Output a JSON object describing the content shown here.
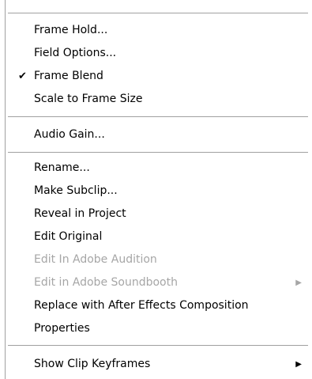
{
  "menu": {
    "items": [
      {
        "label": "Frame Hold...",
        "enabled": true,
        "checked": false
      },
      {
        "label": "Field Options...",
        "enabled": true,
        "checked": false
      },
      {
        "label": "Frame Blend",
        "enabled": true,
        "checked": true,
        "check_glyph": "✔"
      },
      {
        "label": "Scale to Frame Size",
        "enabled": true,
        "checked": false
      },
      {
        "label": "Audio Gain...",
        "enabled": true,
        "checked": false
      },
      {
        "label": "Rename...",
        "enabled": true,
        "checked": false
      },
      {
        "label": "Make Subclip...",
        "enabled": true,
        "checked": false
      },
      {
        "label": "Reveal in Project",
        "enabled": true,
        "checked": false
      },
      {
        "label": "Edit Original",
        "enabled": true,
        "checked": false
      },
      {
        "label": "Edit In Adobe Audition",
        "enabled": false,
        "checked": false
      },
      {
        "label": "Edit in Adobe Soundbooth",
        "enabled": false,
        "checked": false,
        "submenu": true,
        "arrow_glyph": "▶"
      },
      {
        "label": "Replace with After Effects Composition",
        "enabled": true,
        "checked": false
      },
      {
        "label": "Properties",
        "enabled": true,
        "checked": false
      },
      {
        "label": "Show Clip Keyframes",
        "enabled": true,
        "checked": false,
        "submenu": true,
        "arrow_glyph": "▶"
      }
    ]
  },
  "colors": {
    "text": "#000000",
    "disabled_text": "#a6a6a6",
    "separator": "#a0a0a0",
    "background": "#ffffff"
  },
  "icons": {
    "check": "checkmark-icon",
    "submenu": "submenu-arrow-icon"
  }
}
